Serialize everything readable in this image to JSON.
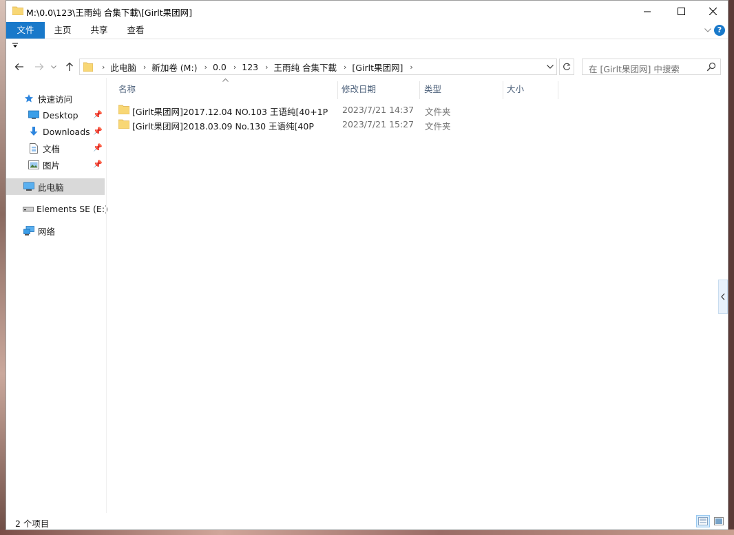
{
  "window": {
    "title": "M:\\0.0\\123\\王雨纯 合集下載\\[Girlt果团网]"
  },
  "ribbon": {
    "tabs": [
      "文件",
      "主页",
      "共享",
      "查看"
    ],
    "help": "?"
  },
  "address": {
    "crumbs": [
      "此电脑",
      "新加卷 (M:)",
      "0.0",
      "123",
      "王雨纯 合集下載",
      "[Girlt果团网]"
    ]
  },
  "search": {
    "placeholder": "在 [Girlt果团网] 中搜索"
  },
  "sidebar": {
    "items": [
      {
        "label": "快速访问",
        "icon": "star-icon"
      },
      {
        "label": "Desktop",
        "icon": "desktop-icon",
        "pinned": true
      },
      {
        "label": "Downloads",
        "icon": "download-icon",
        "pinned": true
      },
      {
        "label": "文档",
        "icon": "document-icon",
        "pinned": true
      },
      {
        "label": "图片",
        "icon": "pictures-icon",
        "pinned": true
      },
      {
        "label": "此电脑",
        "icon": "computer-icon",
        "selected": true
      },
      {
        "label": "Elements SE (E:)",
        "icon": "drive-icon"
      },
      {
        "label": "网络",
        "icon": "network-icon"
      }
    ]
  },
  "columns": {
    "name": "名称",
    "date": "修改日期",
    "type": "类型",
    "size": "大小"
  },
  "files": [
    {
      "name": "[Girlt果团网]2017.12.04 NO.103 王语纯[40+1P",
      "date": "2023/7/21 14:37",
      "type": "文件夹",
      "size": ""
    },
    {
      "name": "[Girlt果团网]2018.03.09 No.130 王语纯[40P",
      "date": "2023/7/21 15:27",
      "type": "文件夹",
      "size": ""
    }
  ],
  "status": {
    "item_count": "2 个项目"
  },
  "colors": {
    "accent": "#1979ca",
    "folder": "#f8d775",
    "selected_bg": "#d9d9d9"
  }
}
